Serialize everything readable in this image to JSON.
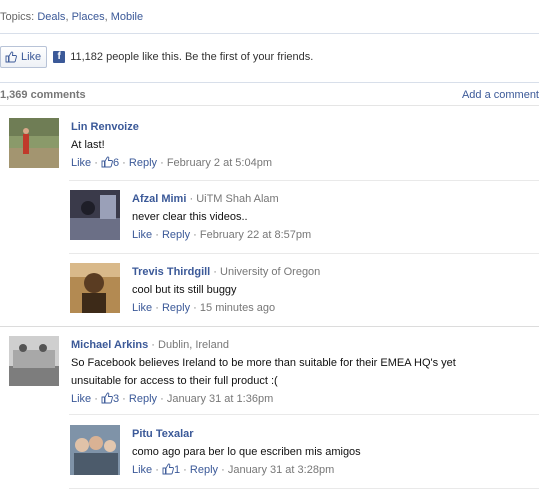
{
  "topics": {
    "prefix": "Topics:",
    "items": [
      "Deals",
      "Places",
      "Mobile"
    ]
  },
  "like_bar": {
    "button_label": "Like",
    "text": "11,182 people like this. Be the first of your friends."
  },
  "comments_header": {
    "count": "1,369 comments",
    "add_label": "Add a comment"
  },
  "comments": [
    {
      "author": "Lin Renvoize",
      "affiliation": "",
      "text": "At last!",
      "like_label": "Like",
      "like_count": "6",
      "reply_label": "Reply",
      "time": "February 2 at 5:04pm"
    },
    {
      "author": "Afzal Mimi",
      "affiliation": "UiTM Shah Alam",
      "text": "never clear this videos..",
      "like_label": "Like",
      "like_count": "",
      "reply_label": "Reply",
      "time": "February 22 at 8:57pm"
    },
    {
      "author": "Trevis Thirdgill",
      "affiliation": "University of Oregon",
      "text": "cool but its still buggy",
      "like_label": "Like",
      "like_count": "",
      "reply_label": "Reply",
      "time": "15 minutes ago"
    },
    {
      "author": "Michael Arkins",
      "affiliation": "Dublin, Ireland",
      "text": "So Facebook believes Ireland to be more than suitable for their EMEA HQ's yet unsuitable for access to their full product :(",
      "like_label": "Like",
      "like_count": "3",
      "reply_label": "Reply",
      "time": "January 31 at 1:36pm"
    },
    {
      "author": "Pitu Texalar",
      "affiliation": "",
      "text": "como ago para ber lo que escriben mis amigos",
      "like_label": "Like",
      "like_count": "1",
      "reply_label": "Reply",
      "time": "January 31 at 3:28pm"
    }
  ],
  "sep": " · ",
  "colors": {
    "link": "#3b5998",
    "meta": "#777777",
    "rule": "#d8dfea"
  }
}
